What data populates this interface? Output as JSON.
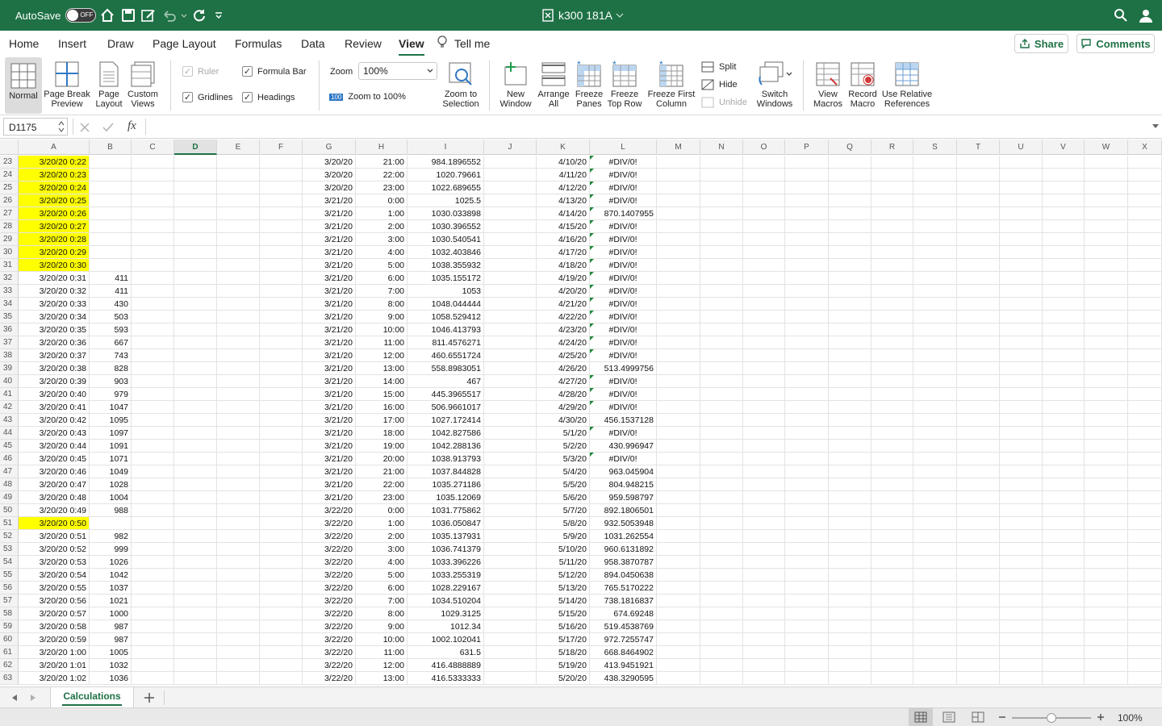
{
  "title_bar": {
    "autosave_label": "AutoSave",
    "autosave_state": "OFF",
    "file_name": "k300 181A"
  },
  "ribbon_tabs": [
    "Home",
    "Insert",
    "Draw",
    "Page Layout",
    "Formulas",
    "Data",
    "Review",
    "View"
  ],
  "tell_me": "Tell me",
  "share_label": "Share",
  "comments_label": "Comments",
  "ribbon": {
    "normal": "Normal",
    "page_break_1": "Page Break",
    "page_break_2": "Preview",
    "page_layout_1": "Page",
    "page_layout_2": "Layout",
    "custom_views_1": "Custom",
    "custom_views_2": "Views",
    "ruler": "Ruler",
    "formula_bar": "Formula Bar",
    "gridlines": "Gridlines",
    "headings": "Headings",
    "zoom_label": "Zoom",
    "zoom_value": "100%",
    "zoom_100": "Zoom to 100%",
    "zoom_100_icon": "100",
    "zoom_sel_1": "Zoom to",
    "zoom_sel_2": "Selection",
    "new_window_1": "New",
    "new_window_2": "Window",
    "arrange_1": "Arrange",
    "arrange_2": "All",
    "freeze_panes_1": "Freeze",
    "freeze_panes_2": "Panes",
    "freeze_top_1": "Freeze",
    "freeze_top_2": "Top Row",
    "freeze_first_1": "Freeze First",
    "freeze_first_2": "Column",
    "split": "Split",
    "hide": "Hide",
    "unhide": "Unhide",
    "switch_1": "Switch",
    "switch_2": "Windows",
    "view_macros_1": "View",
    "view_macros_2": "Macros",
    "record_1": "Record",
    "record_2": "Macro",
    "relative_1": "Use Relative",
    "relative_2": "References"
  },
  "formula_bar": {
    "name_box": "D1175",
    "formula": "",
    "fx": "fx"
  },
  "columns": [
    "A",
    "B",
    "C",
    "D",
    "E",
    "F",
    "G",
    "H",
    "I",
    "J",
    "K",
    "L",
    "M",
    "N",
    "O",
    "P",
    "Q",
    "R",
    "S",
    "T",
    "U",
    "V",
    "W",
    "X"
  ],
  "selected_column": "D",
  "rows": [
    {
      "n": "23",
      "a": "3/20/20 0:22",
      "hl": true,
      "b": "",
      "g": "3/20/20",
      "h": "21:00",
      "i": "984.1896552",
      "k": "4/10/20",
      "l": "#DIV/0!",
      "tri": true
    },
    {
      "n": "24",
      "a": "3/20/20 0:23",
      "hl": true,
      "b": "",
      "g": "3/20/20",
      "h": "22:00",
      "i": "1020.79661",
      "k": "4/11/20",
      "l": "#DIV/0!",
      "tri": true
    },
    {
      "n": "25",
      "a": "3/20/20 0:24",
      "hl": true,
      "b": "",
      "g": "3/20/20",
      "h": "23:00",
      "i": "1022.689655",
      "k": "4/12/20",
      "l": "#DIV/0!",
      "tri": true
    },
    {
      "n": "26",
      "a": "3/20/20 0:25",
      "hl": true,
      "b": "",
      "g": "3/21/20",
      "h": "0:00",
      "i": "1025.5",
      "k": "4/13/20",
      "l": "#DIV/0!",
      "tri": true
    },
    {
      "n": "27",
      "a": "3/20/20 0:26",
      "hl": true,
      "b": "",
      "g": "3/21/20",
      "h": "1:00",
      "i": "1030.033898",
      "k": "4/14/20",
      "l": "870.1407955",
      "tri": true
    },
    {
      "n": "28",
      "a": "3/20/20 0:27",
      "hl": true,
      "b": "",
      "g": "3/21/20",
      "h": "2:00",
      "i": "1030.396552",
      "k": "4/15/20",
      "l": "#DIV/0!",
      "tri": true
    },
    {
      "n": "29",
      "a": "3/20/20 0:28",
      "hl": true,
      "b": "",
      "g": "3/21/20",
      "h": "3:00",
      "i": "1030.540541",
      "k": "4/16/20",
      "l": "#DIV/0!",
      "tri": true
    },
    {
      "n": "30",
      "a": "3/20/20 0:29",
      "hl": true,
      "b": "",
      "g": "3/21/20",
      "h": "4:00",
      "i": "1032.403846",
      "k": "4/17/20",
      "l": "#DIV/0!",
      "tri": true
    },
    {
      "n": "31",
      "a": "3/20/20 0:30",
      "hl": true,
      "b": "",
      "g": "3/21/20",
      "h": "5:00",
      "i": "1038.355932",
      "k": "4/18/20",
      "l": "#DIV/0!",
      "tri": true
    },
    {
      "n": "32",
      "a": "3/20/20 0:31",
      "hl": false,
      "b": "411",
      "g": "3/21/20",
      "h": "6:00",
      "i": "1035.155172",
      "k": "4/19/20",
      "l": "#DIV/0!",
      "tri": true
    },
    {
      "n": "33",
      "a": "3/20/20 0:32",
      "hl": false,
      "b": "411",
      "g": "3/21/20",
      "h": "7:00",
      "i": "1053",
      "k": "4/20/20",
      "l": "#DIV/0!",
      "tri": true
    },
    {
      "n": "34",
      "a": "3/20/20 0:33",
      "hl": false,
      "b": "430",
      "g": "3/21/20",
      "h": "8:00",
      "i": "1048.044444",
      "k": "4/21/20",
      "l": "#DIV/0!",
      "tri": true
    },
    {
      "n": "35",
      "a": "3/20/20 0:34",
      "hl": false,
      "b": "503",
      "g": "3/21/20",
      "h": "9:00",
      "i": "1058.529412",
      "k": "4/22/20",
      "l": "#DIV/0!",
      "tri": true
    },
    {
      "n": "36",
      "a": "3/20/20 0:35",
      "hl": false,
      "b": "593",
      "g": "3/21/20",
      "h": "10:00",
      "i": "1046.413793",
      "k": "4/23/20",
      "l": "#DIV/0!",
      "tri": true
    },
    {
      "n": "37",
      "a": "3/20/20 0:36",
      "hl": false,
      "b": "667",
      "g": "3/21/20",
      "h": "11:00",
      "i": "811.4576271",
      "k": "4/24/20",
      "l": "#DIV/0!",
      "tri": true
    },
    {
      "n": "38",
      "a": "3/20/20 0:37",
      "hl": false,
      "b": "743",
      "g": "3/21/20",
      "h": "12:00",
      "i": "460.6551724",
      "k": "4/25/20",
      "l": "#DIV/0!",
      "tri": true
    },
    {
      "n": "39",
      "a": "3/20/20 0:38",
      "hl": false,
      "b": "828",
      "g": "3/21/20",
      "h": "13:00",
      "i": "558.8983051",
      "k": "4/26/20",
      "l": "513.4999756",
      "tri": false
    },
    {
      "n": "40",
      "a": "3/20/20 0:39",
      "hl": false,
      "b": "903",
      "g": "3/21/20",
      "h": "14:00",
      "i": "467",
      "k": "4/27/20",
      "l": "#DIV/0!",
      "tri": true
    },
    {
      "n": "41",
      "a": "3/20/20 0:40",
      "hl": false,
      "b": "979",
      "g": "3/21/20",
      "h": "15:00",
      "i": "445.3965517",
      "k": "4/28/20",
      "l": "#DIV/0!",
      "tri": true
    },
    {
      "n": "42",
      "a": "3/20/20 0:41",
      "hl": false,
      "b": "1047",
      "g": "3/21/20",
      "h": "16:00",
      "i": "506.9661017",
      "k": "4/29/20",
      "l": "#DIV/0!",
      "tri": true
    },
    {
      "n": "43",
      "a": "3/20/20 0:42",
      "hl": false,
      "b": "1095",
      "g": "3/21/20",
      "h": "17:00",
      "i": "1027.172414",
      "k": "4/30/20",
      "l": "456.1537128",
      "tri": false
    },
    {
      "n": "44",
      "a": "3/20/20 0:43",
      "hl": false,
      "b": "1097",
      "g": "3/21/20",
      "h": "18:00",
      "i": "1042.827586",
      "k": "5/1/20",
      "l": "#DIV/0!",
      "tri": true
    },
    {
      "n": "45",
      "a": "3/20/20 0:44",
      "hl": false,
      "b": "1091",
      "g": "3/21/20",
      "h": "19:00",
      "i": "1042.288136",
      "k": "5/2/20",
      "l": "430.996947",
      "tri": false
    },
    {
      "n": "46",
      "a": "3/20/20 0:45",
      "hl": false,
      "b": "1071",
      "g": "3/21/20",
      "h": "20:00",
      "i": "1038.913793",
      "k": "5/3/20",
      "l": "#DIV/0!",
      "tri": true
    },
    {
      "n": "47",
      "a": "3/20/20 0:46",
      "hl": false,
      "b": "1049",
      "g": "3/21/20",
      "h": "21:00",
      "i": "1037.844828",
      "k": "5/4/20",
      "l": "963.045904",
      "tri": false
    },
    {
      "n": "48",
      "a": "3/20/20 0:47",
      "hl": false,
      "b": "1028",
      "g": "3/21/20",
      "h": "22:00",
      "i": "1035.271186",
      "k": "5/5/20",
      "l": "804.948215",
      "tri": false
    },
    {
      "n": "49",
      "a": "3/20/20 0:48",
      "hl": false,
      "b": "1004",
      "g": "3/21/20",
      "h": "23:00",
      "i": "1035.12069",
      "k": "5/6/20",
      "l": "959.598797",
      "tri": false
    },
    {
      "n": "50",
      "a": "3/20/20 0:49",
      "hl": false,
      "b": "988",
      "g": "3/22/20",
      "h": "0:00",
      "i": "1031.775862",
      "k": "5/7/20",
      "l": "892.1806501",
      "tri": false
    },
    {
      "n": "51",
      "a": "3/20/20 0:50",
      "hl": true,
      "b": "",
      "g": "3/22/20",
      "h": "1:00",
      "i": "1036.050847",
      "k": "5/8/20",
      "l": "932.5053948",
      "tri": false
    },
    {
      "n": "52",
      "a": "3/20/20 0:51",
      "hl": false,
      "b": "982",
      "g": "3/22/20",
      "h": "2:00",
      "i": "1035.137931",
      "k": "5/9/20",
      "l": "1031.262554",
      "tri": false
    },
    {
      "n": "53",
      "a": "3/20/20 0:52",
      "hl": false,
      "b": "999",
      "g": "3/22/20",
      "h": "3:00",
      "i": "1036.741379",
      "k": "5/10/20",
      "l": "960.6131892",
      "tri": false
    },
    {
      "n": "54",
      "a": "3/20/20 0:53",
      "hl": false,
      "b": "1026",
      "g": "3/22/20",
      "h": "4:00",
      "i": "1033.396226",
      "k": "5/11/20",
      "l": "958.3870787",
      "tri": false
    },
    {
      "n": "55",
      "a": "3/20/20 0:54",
      "hl": false,
      "b": "1042",
      "g": "3/22/20",
      "h": "5:00",
      "i": "1033.255319",
      "k": "5/12/20",
      "l": "894.0450638",
      "tri": false
    },
    {
      "n": "56",
      "a": "3/20/20 0:55",
      "hl": false,
      "b": "1037",
      "g": "3/22/20",
      "h": "6:00",
      "i": "1028.229167",
      "k": "5/13/20",
      "l": "765.5170222",
      "tri": false
    },
    {
      "n": "57",
      "a": "3/20/20 0:56",
      "hl": false,
      "b": "1021",
      "g": "3/22/20",
      "h": "7:00",
      "i": "1034.510204",
      "k": "5/14/20",
      "l": "738.1816837",
      "tri": false
    },
    {
      "n": "58",
      "a": "3/20/20 0:57",
      "hl": false,
      "b": "1000",
      "g": "3/22/20",
      "h": "8:00",
      "i": "1029.3125",
      "k": "5/15/20",
      "l": "674.69248",
      "tri": false
    },
    {
      "n": "59",
      "a": "3/20/20 0:58",
      "hl": false,
      "b": "987",
      "g": "3/22/20",
      "h": "9:00",
      "i": "1012.34",
      "k": "5/16/20",
      "l": "519.4538769",
      "tri": false
    },
    {
      "n": "60",
      "a": "3/20/20 0:59",
      "hl": false,
      "b": "987",
      "g": "3/22/20",
      "h": "10:00",
      "i": "1002.102041",
      "k": "5/17/20",
      "l": "972.7255747",
      "tri": false
    },
    {
      "n": "61",
      "a": "3/20/20 1:00",
      "hl": false,
      "b": "1005",
      "g": "3/22/20",
      "h": "11:00",
      "i": "631.5",
      "k": "5/18/20",
      "l": "668.8464902",
      "tri": false
    },
    {
      "n": "62",
      "a": "3/20/20 1:01",
      "hl": false,
      "b": "1032",
      "g": "3/22/20",
      "h": "12:00",
      "i": "416.4888889",
      "k": "5/19/20",
      "l": "413.9451921",
      "tri": false
    },
    {
      "n": "63",
      "a": "3/20/20 1:02",
      "hl": false,
      "b": "1036",
      "g": "3/22/20",
      "h": "13:00",
      "i": "416.5333333",
      "k": "5/20/20",
      "l": "438.3290595",
      "tri": false
    }
  ],
  "sheet_tab": "Calculations",
  "zoom_percent": "100%",
  "colors": {
    "accent": "#1e7145",
    "highlight": "#ffff00",
    "error_flag": "#1e8a3c"
  }
}
